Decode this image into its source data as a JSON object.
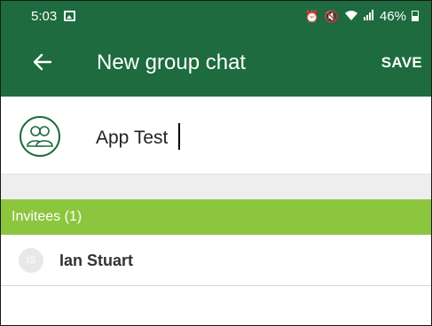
{
  "status_bar": {
    "time": "5:03",
    "battery": "46%",
    "icons": [
      "gallery-icon",
      "alarm-icon",
      "mute-icon",
      "wifi-icon",
      "signal-icon",
      "battery-icon"
    ]
  },
  "app_bar": {
    "back_icon": "arrow-left-icon",
    "title": "New group chat",
    "save_label": "SAVE"
  },
  "group": {
    "avatar_icon": "group-icon",
    "name_value": "App Test"
  },
  "invitees": {
    "header": "Invitees (1)",
    "items": [
      {
        "initials": "IS",
        "name": "Ian Stuart"
      }
    ]
  },
  "colors": {
    "brand_green": "#1d6b3e",
    "section_green": "#8cc63f"
  }
}
